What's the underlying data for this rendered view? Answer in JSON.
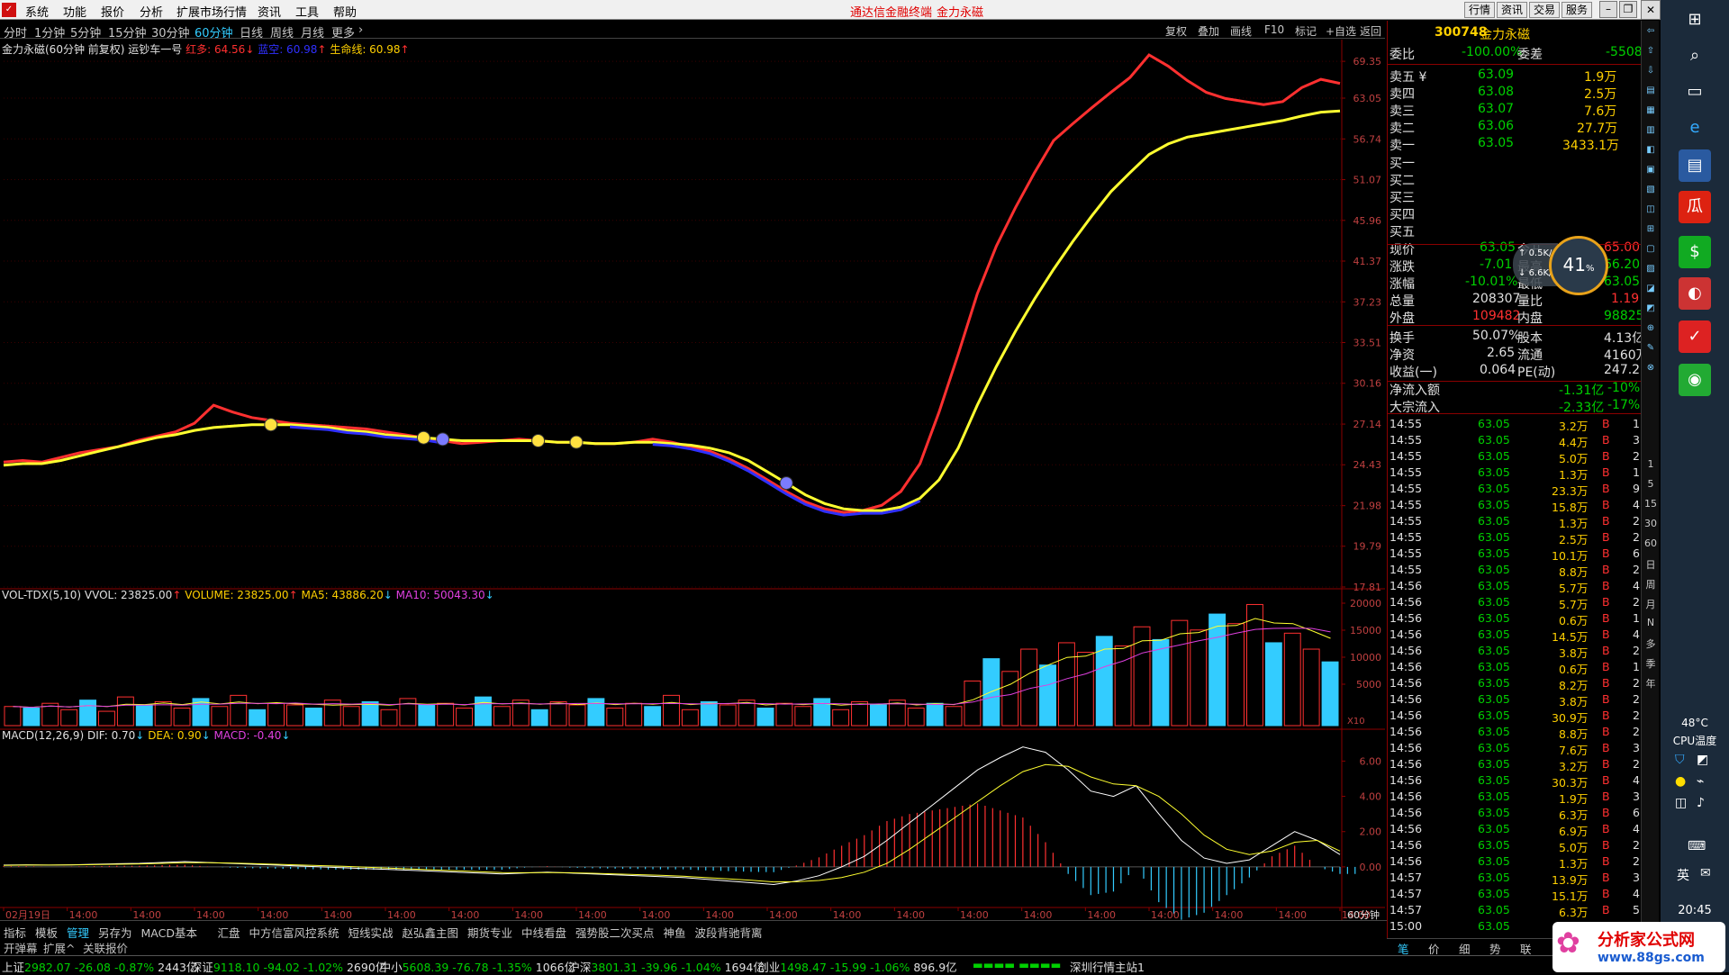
{
  "menubar": {
    "items": [
      "系统",
      "功能",
      "报价",
      "分析",
      "扩展市场行情",
      "资讯",
      "工具",
      "帮助"
    ],
    "center_left": "通达信金融终端",
    "center_right": "金力永磁",
    "right_buttons": [
      "行情",
      "资讯",
      "交易",
      "服务"
    ]
  },
  "periodbar": {
    "periods": [
      "分时",
      "1分钟",
      "5分钟",
      "15分钟",
      "30分钟",
      "60分钟",
      "日线",
      "周线",
      "月线",
      "更多"
    ],
    "active": "60分钟",
    "right_tools": [
      "复权",
      "叠加",
      "画线",
      "F10",
      "标记",
      "+自选",
      "返回"
    ]
  },
  "main_indicator": {
    "title": "金力永磁(60分钟 前复权) 运钞车一号",
    "red_label": "红多: 64.56",
    "blue_label": "蓝空: 60.98",
    "yellow_label": "生命线: 60.98",
    "colors": {
      "red": "#ff3030",
      "blue": "#3030ff",
      "yellow": "#ffff30"
    }
  },
  "vol_indicator": {
    "name": "VOL-TDX(5,10)",
    "vvol": "VVOL: 23825.00",
    "volume": "VOLUME: 23825.00",
    "ma5": "MA5: 43886.20",
    "ma10": "MA10: 50043.30",
    "unit": "X10"
  },
  "macd_indicator": {
    "name": "MACD(12,26,9)",
    "dif": "DIF: 0.70",
    "dea": "DEA: 0.90",
    "macd": "MACD: -0.40"
  },
  "chart_data": {
    "type": "line",
    "main_yticks": [
      "69.35",
      "63.05",
      "56.74",
      "51.07",
      "45.96",
      "41.37",
      "37.23",
      "33.51",
      "30.16",
      "27.14",
      "24.43",
      "21.98",
      "19.79",
      "17.81"
    ],
    "vol_yticks": [
      "20000",
      "15000",
      "10000",
      "5000"
    ],
    "macd_yticks": [
      "6.00",
      "4.00",
      "2.00",
      "0.00"
    ],
    "x_labels": [
      "02月19日",
      "14:00",
      "14:00",
      "14:00",
      "14:00",
      "14:00",
      "14:00",
      "14:00",
      "14:00",
      "14:00",
      "14:00",
      "14:00",
      "14:00",
      "14:00",
      "14:00",
      "14:00",
      "14:00",
      "14:00",
      "14:00",
      "14:00",
      "14:00",
      "14:00"
    ],
    "period_label": "60分钟",
    "red_line": [
      24.6,
      24.7,
      24.6,
      24.9,
      25.2,
      25.4,
      25.6,
      26.0,
      26.3,
      26.6,
      27.2,
      28.5,
      28.0,
      27.6,
      27.4,
      27.2,
      27.1,
      27.0,
      26.9,
      26.8,
      26.6,
      26.4,
      26.2,
      26.0,
      25.8,
      25.9,
      26.0,
      26.1,
      26.0,
      25.9,
      25.9,
      25.8,
      25.8,
      25.9,
      26.1,
      25.9,
      25.6,
      25.3,
      24.8,
      24.2,
      23.5,
      22.8,
      22.2,
      21.8,
      21.6,
      21.7,
      22.0,
      22.8,
      24.5,
      28,
      32.5,
      38,
      43,
      47.5,
      52,
      56.5,
      59,
      61.5,
      64,
      66.5,
      70.5,
      68.5,
      66,
      64,
      63,
      62.5,
      62,
      62.5,
      64.8,
      66.2,
      65.5
    ],
    "yellow_line": [
      24.4,
      24.5,
      24.5,
      24.7,
      25.0,
      25.3,
      25.6,
      25.9,
      26.2,
      26.4,
      26.7,
      26.9,
      27.0,
      27.1,
      27.1,
      27.1,
      27.0,
      26.9,
      26.7,
      26.6,
      26.4,
      26.3,
      26.2,
      26.1,
      26.0,
      26.0,
      26.0,
      26.0,
      26.0,
      25.9,
      25.9,
      25.8,
      25.8,
      25.9,
      25.9,
      25.8,
      25.7,
      25.5,
      25.2,
      24.7,
      24.0,
      23.3,
      22.6,
      22.1,
      21.8,
      21.7,
      21.7,
      21.9,
      22.4,
      23.5,
      25.5,
      28.5,
      31.5,
      34.5,
      37.5,
      40.5,
      43.5,
      46.5,
      49.5,
      52,
      54.5,
      56,
      57,
      57.5,
      58,
      58.5,
      59,
      59.5,
      60.2,
      60.8,
      61.0
    ],
    "blue_segments": [
      [
        15,
        23
      ],
      [
        34,
        48
      ]
    ],
    "smileys_at": [
      14,
      22,
      23,
      28,
      30,
      41
    ],
    "volume": [
      60,
      55,
      70,
      50,
      80,
      45,
      90,
      65,
      75,
      55,
      85,
      60,
      95,
      50,
      70,
      65,
      55,
      80,
      60,
      75,
      50,
      85,
      65,
      70,
      55,
      90,
      60,
      80,
      50,
      75,
      65,
      85,
      55,
      70,
      60,
      95,
      50,
      75,
      65,
      80,
      55,
      70,
      60,
      85,
      50,
      75,
      65,
      80,
      55,
      70,
      60,
      140,
      210,
      170,
      240,
      190,
      260,
      230,
      280,
      250,
      310,
      270,
      330,
      300,
      350,
      320,
      380,
      260,
      290,
      240,
      200
    ],
    "macd_dif": [
      0.1,
      0.12,
      0.1,
      0.12,
      0.15,
      0.18,
      0.2,
      0.25,
      0.3,
      0.25,
      0.2,
      0.15,
      0.1,
      0.05,
      0.0,
      -0.05,
      -0.1,
      -0.15,
      -0.2,
      -0.25,
      -0.3,
      -0.35,
      -0.4,
      -0.35,
      -0.3,
      -0.35,
      -0.4,
      -0.45,
      -0.5,
      -0.55,
      -0.6,
      -0.7,
      -0.8,
      -0.9,
      -1.0,
      -0.8,
      -0.5,
      0.0,
      0.6,
      1.5,
      2.5,
      3.5,
      4.5,
      5.5,
      6.2,
      6.8,
      6.5,
      5.5,
      4.3,
      4.0,
      4.6,
      3.0,
      1.5,
      0.5,
      0.2,
      0.4,
      1.2,
      2.0,
      1.5,
      0.7
    ],
    "macd_dea": [
      0.08,
      0.1,
      0.1,
      0.11,
      0.13,
      0.15,
      0.17,
      0.2,
      0.24,
      0.24,
      0.22,
      0.19,
      0.15,
      0.11,
      0.07,
      0.03,
      -0.02,
      -0.07,
      -0.12,
      -0.17,
      -0.22,
      -0.27,
      -0.32,
      -0.33,
      -0.32,
      -0.33,
      -0.36,
      -0.4,
      -0.44,
      -0.48,
      -0.53,
      -0.6,
      -0.68,
      -0.76,
      -0.85,
      -0.84,
      -0.77,
      -0.6,
      -0.3,
      0.2,
      1.0,
      1.9,
      2.8,
      3.7,
      4.6,
      5.4,
      5.8,
      5.7,
      5.1,
      4.7,
      4.6,
      4.0,
      3.0,
      1.8,
      1.0,
      0.7,
      0.9,
      1.4,
      1.5,
      0.9
    ]
  },
  "right_panel": {
    "code": "300748",
    "name": "金力永磁",
    "weibi_label": "委比",
    "weibi_value": "-100.00%",
    "weicha_label": "委差",
    "weicha_value": "-5508",
    "sells": [
      {
        "label": "卖五",
        "price": "63.09",
        "vol": "1.9万"
      },
      {
        "label": "卖四",
        "price": "63.08",
        "vol": "2.5万"
      },
      {
        "label": "卖三",
        "price": "63.07",
        "vol": "7.6万"
      },
      {
        "label": "卖二",
        "price": "63.06",
        "vol": "27.7万"
      },
      {
        "label": "卖一",
        "price": "63.05",
        "vol": "3433.1万"
      }
    ],
    "buys": [
      "买一",
      "买二",
      "买三",
      "买四",
      "买五"
    ],
    "quote": [
      {
        "l": "现价",
        "v": "63.05",
        "l2": "今开",
        "v2": "65.00"
      },
      {
        "l": "涨跌",
        "v": "-7.01",
        "l2": "最高",
        "v2": "66.20"
      },
      {
        "l": "涨幅",
        "v": "-10.01%",
        "l2": "最低",
        "v2": "63.05"
      },
      {
        "l": "总量",
        "v": "208307",
        "l2": "量比",
        "v2": "1.19"
      },
      {
        "l": "外盘",
        "v": "109482",
        "l2": "内盘",
        "v2": "98825"
      }
    ],
    "fund": [
      {
        "l": "换手",
        "v": "50.07%",
        "l2": "股本",
        "v2": "4.13亿"
      },
      {
        "l": "净资",
        "v": "2.65",
        "l2": "流通",
        "v2": "4160万"
      },
      {
        "l": "收益(一)",
        "v": "0.064",
        "l2": "PE(动)",
        "v2": "247.2"
      }
    ],
    "flow": [
      {
        "l": "净流入额",
        "v": "-1.31亿",
        "p": "-10%"
      },
      {
        "l": "大宗流入",
        "v": "-2.33亿",
        "p": "-17%"
      }
    ],
    "trades": [
      [
        "14:55",
        "63.05",
        "3.2万",
        "B",
        "1"
      ],
      [
        "14:55",
        "63.05",
        "4.4万",
        "B",
        "3"
      ],
      [
        "14:55",
        "63.05",
        "5.0万",
        "B",
        "2"
      ],
      [
        "14:55",
        "63.05",
        "1.3万",
        "B",
        "1"
      ],
      [
        "14:55",
        "63.05",
        "23.3万",
        "B",
        "9"
      ],
      [
        "14:55",
        "63.05",
        "15.8万",
        "B",
        "4"
      ],
      [
        "14:55",
        "63.05",
        "1.3万",
        "B",
        "2"
      ],
      [
        "14:55",
        "63.05",
        "2.5万",
        "B",
        "2"
      ],
      [
        "14:55",
        "63.05",
        "10.1万",
        "B",
        "6"
      ],
      [
        "14:55",
        "63.05",
        "8.8万",
        "B",
        "2"
      ],
      [
        "14:56",
        "63.05",
        "5.7万",
        "B",
        "4"
      ],
      [
        "14:56",
        "63.05",
        "5.7万",
        "B",
        "2"
      ],
      [
        "14:56",
        "63.05",
        "0.6万",
        "B",
        "1"
      ],
      [
        "14:56",
        "63.05",
        "14.5万",
        "B",
        "4"
      ],
      [
        "14:56",
        "63.05",
        "3.8万",
        "B",
        "2"
      ],
      [
        "14:56",
        "63.05",
        "0.6万",
        "B",
        "1"
      ],
      [
        "14:56",
        "63.05",
        "8.2万",
        "B",
        "2"
      ],
      [
        "14:56",
        "63.05",
        "3.8万",
        "B",
        "2"
      ],
      [
        "14:56",
        "63.05",
        "30.9万",
        "B",
        "2"
      ],
      [
        "14:56",
        "63.05",
        "8.8万",
        "B",
        "2"
      ],
      [
        "14:56",
        "63.05",
        "7.6万",
        "B",
        "3"
      ],
      [
        "14:56",
        "63.05",
        "3.2万",
        "B",
        "2"
      ],
      [
        "14:56",
        "63.05",
        "30.3万",
        "B",
        "4"
      ],
      [
        "14:56",
        "63.05",
        "1.9万",
        "B",
        "3"
      ],
      [
        "14:56",
        "63.05",
        "6.3万",
        "B",
        "6"
      ],
      [
        "14:56",
        "63.05",
        "6.9万",
        "B",
        "4"
      ],
      [
        "14:56",
        "63.05",
        "5.0万",
        "B",
        "2"
      ],
      [
        "14:56",
        "63.05",
        "1.3万",
        "B",
        "2"
      ],
      [
        "14:57",
        "63.05",
        "13.9万",
        "B",
        "3"
      ],
      [
        "14:57",
        "63.05",
        "15.1万",
        "B",
        "4"
      ],
      [
        "14:57",
        "63.05",
        "6.3万",
        "B",
        "5"
      ],
      [
        "15:00",
        "63.05",
        "",
        "",
        ""
      ]
    ],
    "tabs": [
      "笔",
      "价",
      "细",
      "势",
      "联"
    ]
  },
  "gauge": {
    "value": "41",
    "unit": "%",
    "up": "0.5K/s",
    "down": "6.6K/s"
  },
  "bottom_tabs": [
    "指标",
    "模板",
    "管理",
    "另存为",
    "MACD基本",
    "汇盘",
    "中方信富风控系统",
    "短线实战",
    "赵弘鑫主图",
    "期货专业",
    "中线看盘",
    "强势股二次买点",
    "神鱼",
    "波段背驰背离"
  ],
  "bottom_tabs_active": "管理",
  "bottom_row2": [
    "开弹幕",
    "扩展^",
    "关联报价"
  ],
  "status": [
    {
      "name": "上证",
      "v": "2982.07",
      "c": "-26.08",
      "p": "-0.87%",
      "a": "2443亿"
    },
    {
      "name": "深证",
      "v": "9118.10",
      "c": "-94.02",
      "p": "-1.02%",
      "a": "2690亿"
    },
    {
      "name": "中小",
      "v": "5608.39",
      "c": "-76.78",
      "p": "-1.35%",
      "a": "1066亿"
    },
    {
      "name": "沪深",
      "v": "3801.31",
      "c": "-39.96",
      "p": "-1.04%",
      "a": "1694亿"
    },
    {
      "name": "创业",
      "v": "1498.47",
      "c": "-15.99",
      "p": "-1.06%",
      "a": "896.9亿"
    }
  ],
  "status_right": "深圳行情主站1",
  "taskbar": {
    "temp": "48°C",
    "cpu_label": "CPU温度",
    "lang": "英",
    "time": "20:45"
  },
  "watermark": {
    "title": "分析家公式网",
    "url": "www.88gs.com"
  },
  "toolstrip": [
    "1",
    "5",
    "15",
    "30",
    "60",
    "日",
    "周",
    "月",
    "N",
    "多",
    "季",
    "年"
  ]
}
